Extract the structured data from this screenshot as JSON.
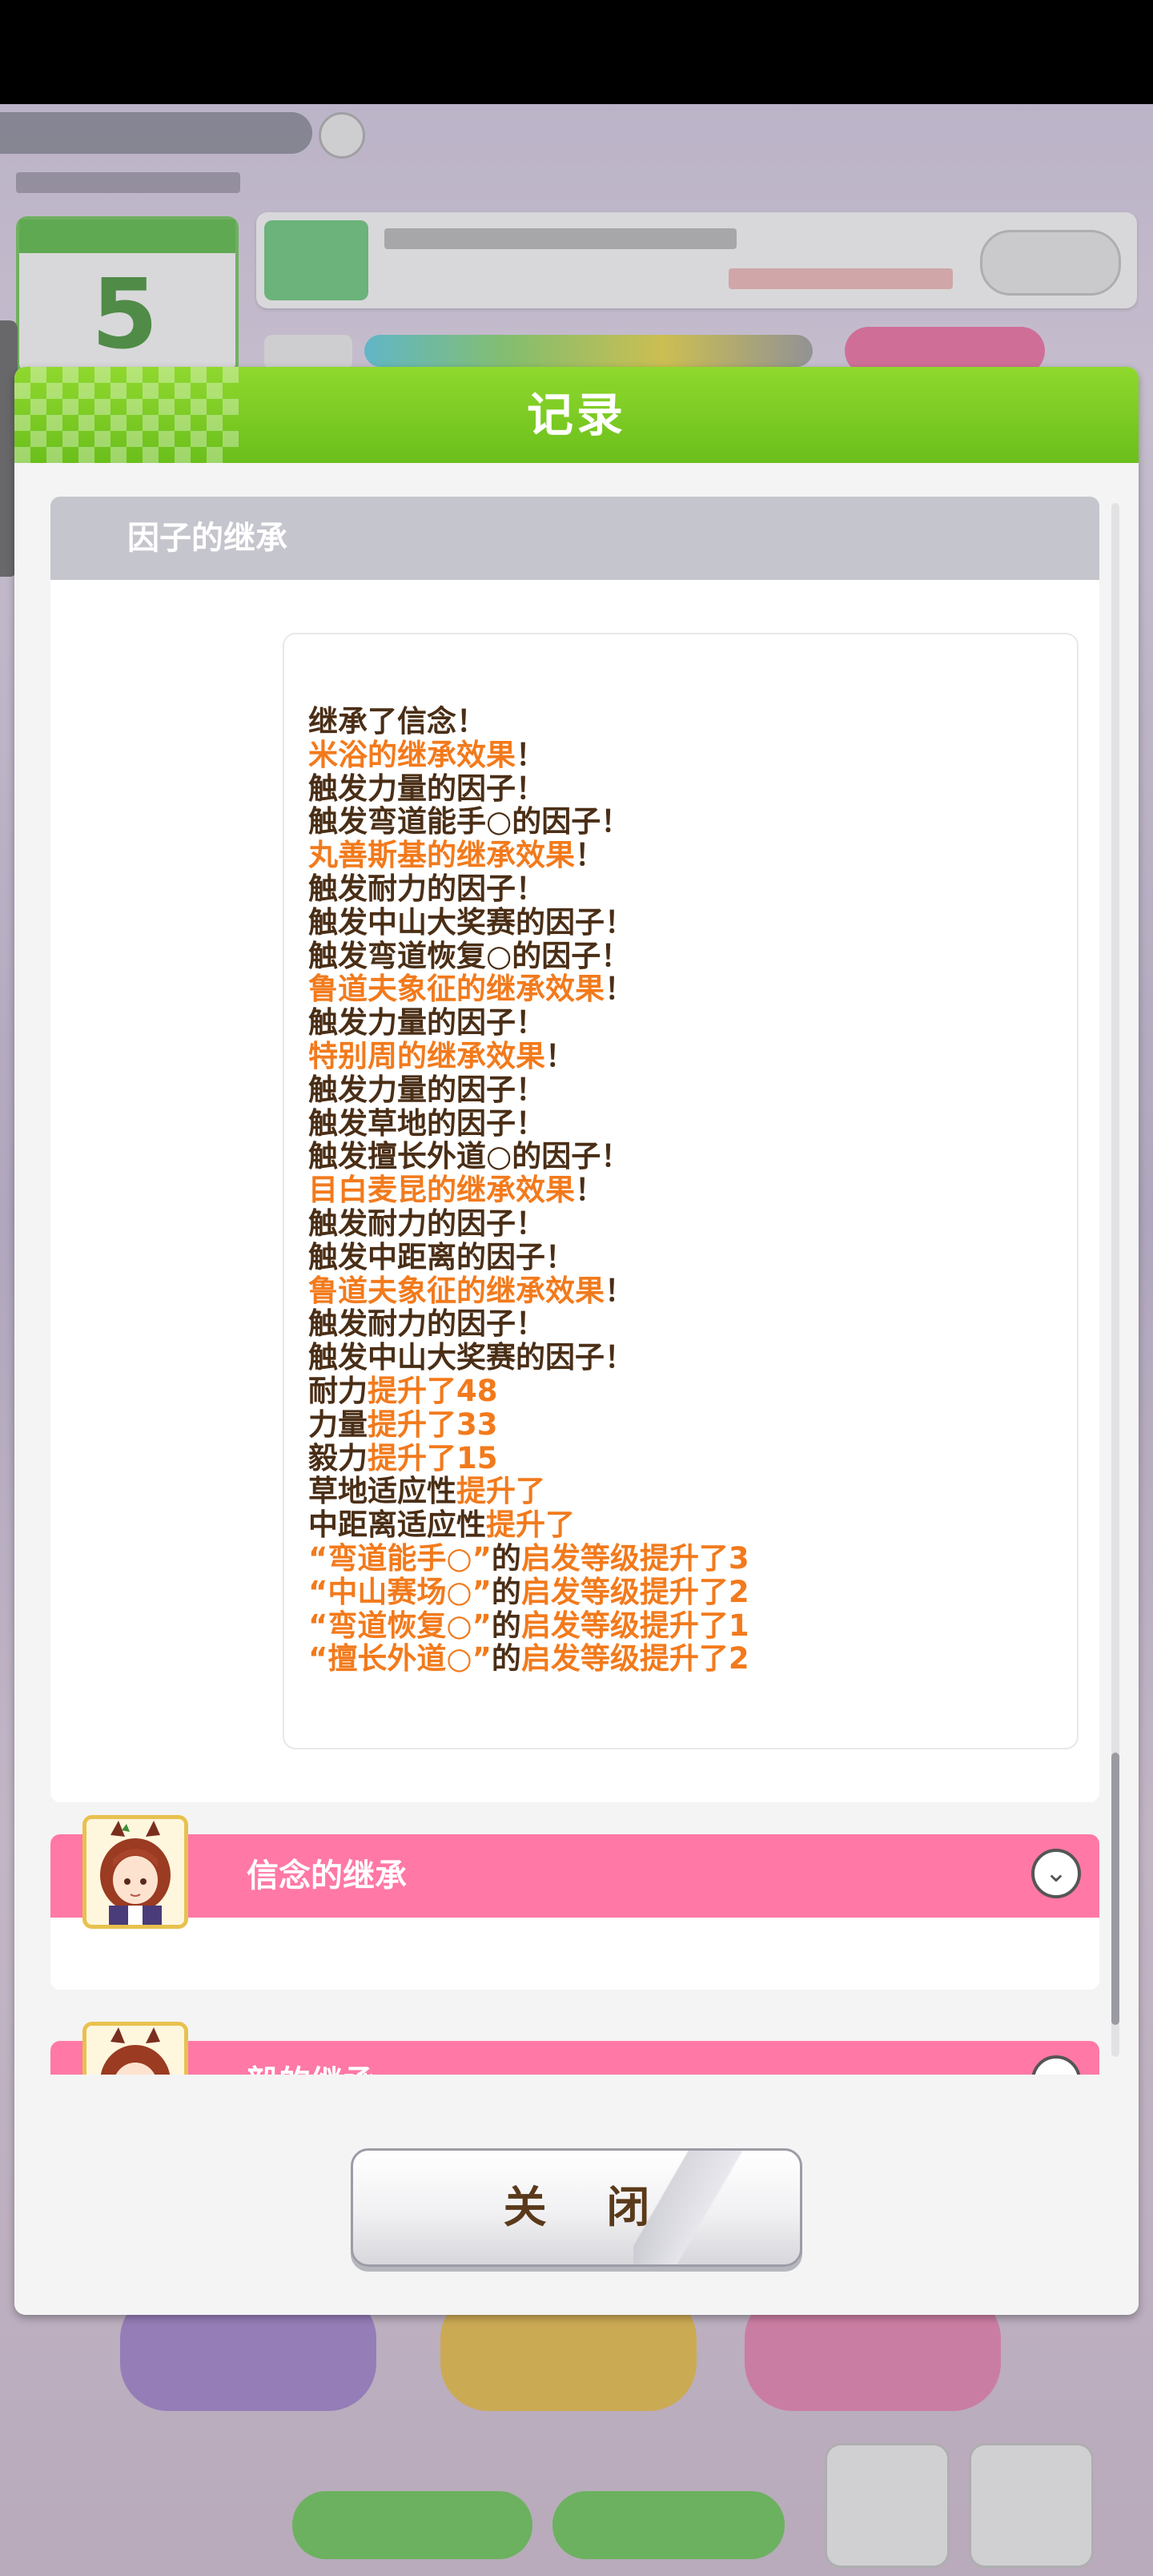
{
  "dialog": {
    "title": "记录",
    "close_label": "关 闭"
  },
  "section": {
    "title": "因子的继承",
    "log": [
      {
        "parts": [
          {
            "text": "继承了信念！",
            "hi": false
          }
        ]
      },
      {
        "parts": [
          {
            "text": "米浴的继承效果",
            "hi": true
          },
          {
            "text": "！",
            "hi": false
          }
        ]
      },
      {
        "parts": [
          {
            "text": "触发力量的因子！",
            "hi": false
          }
        ]
      },
      {
        "parts": [
          {
            "text": "触发弯道能手○的因子！",
            "hi": false
          }
        ]
      },
      {
        "parts": [
          {
            "text": "丸善斯基的继承效果",
            "hi": true
          },
          {
            "text": "！",
            "hi": false
          }
        ]
      },
      {
        "parts": [
          {
            "text": "触发耐力的因子！",
            "hi": false
          }
        ]
      },
      {
        "parts": [
          {
            "text": "触发中山大奖赛的因子！",
            "hi": false
          }
        ]
      },
      {
        "parts": [
          {
            "text": "触发弯道恢复○的因子！",
            "hi": false
          }
        ]
      },
      {
        "parts": [
          {
            "text": "鲁道夫象征的继承效果",
            "hi": true
          },
          {
            "text": "！",
            "hi": false
          }
        ]
      },
      {
        "parts": [
          {
            "text": "触发力量的因子！",
            "hi": false
          }
        ]
      },
      {
        "parts": [
          {
            "text": "特别周的继承效果",
            "hi": true
          },
          {
            "text": "！",
            "hi": false
          }
        ]
      },
      {
        "parts": [
          {
            "text": "触发力量的因子！",
            "hi": false
          }
        ]
      },
      {
        "parts": [
          {
            "text": "触发草地的因子！",
            "hi": false
          }
        ]
      },
      {
        "parts": [
          {
            "text": "触发擅长外道○的因子！",
            "hi": false
          }
        ]
      },
      {
        "parts": [
          {
            "text": "目白麦昆的继承效果",
            "hi": true
          },
          {
            "text": "！",
            "hi": false
          }
        ]
      },
      {
        "parts": [
          {
            "text": "触发耐力的因子！",
            "hi": false
          }
        ]
      },
      {
        "parts": [
          {
            "text": "触发中距离的因子！",
            "hi": false
          }
        ]
      },
      {
        "parts": [
          {
            "text": "鲁道夫象征的继承效果",
            "hi": true
          },
          {
            "text": "！",
            "hi": false
          }
        ]
      },
      {
        "parts": [
          {
            "text": "触发耐力的因子！",
            "hi": false
          }
        ]
      },
      {
        "parts": [
          {
            "text": "触发中山大奖赛的因子！",
            "hi": false
          }
        ]
      },
      {
        "parts": [
          {
            "text": "耐力",
            "hi": false
          },
          {
            "text": "提升了48",
            "hi": true
          }
        ]
      },
      {
        "parts": [
          {
            "text": "力量",
            "hi": false
          },
          {
            "text": "提升了33",
            "hi": true
          }
        ]
      },
      {
        "parts": [
          {
            "text": "毅力",
            "hi": false
          },
          {
            "text": "提升了15",
            "hi": true
          }
        ]
      },
      {
        "parts": [
          {
            "text": "草地适应性",
            "hi": false
          },
          {
            "text": "提升了",
            "hi": true
          }
        ]
      },
      {
        "parts": [
          {
            "text": "中距离适应性",
            "hi": false
          },
          {
            "text": "提升了",
            "hi": true
          }
        ]
      },
      {
        "parts": [
          {
            "text": "“弯道能手○”",
            "hi": true
          },
          {
            "text": "的",
            "hi": false
          },
          {
            "text": "启发等级提升了3",
            "hi": true
          }
        ]
      },
      {
        "parts": [
          {
            "text": "“中山赛场○”",
            "hi": true
          },
          {
            "text": "的",
            "hi": false
          },
          {
            "text": "启发等级提升了2",
            "hi": true
          }
        ]
      },
      {
        "parts": [
          {
            "text": "“弯道恢复○”",
            "hi": true
          },
          {
            "text": "的",
            "hi": false
          },
          {
            "text": "启发等级提升了1",
            "hi": true
          }
        ]
      },
      {
        "parts": [
          {
            "text": "“擅长外道○”",
            "hi": true
          },
          {
            "text": "的",
            "hi": false
          },
          {
            "text": "启发等级提升了2",
            "hi": true
          }
        ]
      }
    ]
  },
  "accordion": [
    {
      "title": "信念的继承",
      "icon": "chevron-down-icon"
    },
    {
      "title": "毅的继承",
      "icon": "chevron-down-icon"
    }
  ],
  "colors": {
    "header_green": "#6bbf1b",
    "log_text": "#4a2e16",
    "log_highlight": "#f27a1c",
    "accordion_pink": "#ff78a6",
    "section_gray": "#c5c5cd"
  }
}
